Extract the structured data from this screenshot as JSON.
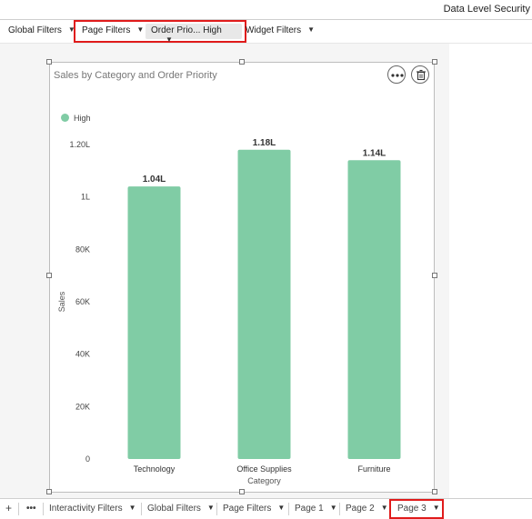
{
  "header": {
    "title": "Data Level Security"
  },
  "filters": {
    "global_label": "Global Filters",
    "page_label": "Page Filters",
    "order_chip": "Order Prio... High",
    "widget_label": "Widget Filters"
  },
  "widget": {
    "title": "Sales by Category and Order Priority",
    "more_icon": "more-dots-icon",
    "delete_icon": "trash-icon"
  },
  "chart_data": {
    "type": "bar",
    "title": "Sales by Category and Order Priority",
    "categories": [
      "Technology",
      "Office Supplies",
      "Furniture"
    ],
    "series": [
      {
        "name": "High",
        "values": [
          104000,
          118000,
          114000
        ],
        "labels": [
          "1.04L",
          "1.18L",
          "1.14L"
        ],
        "color": "#80cca5"
      }
    ],
    "xlabel": "Category",
    "ylabel": "Sales",
    "ylim": [
      0,
      120000
    ],
    "yticks": [
      0,
      20000,
      40000,
      60000,
      80000,
      100000,
      120000
    ],
    "ytick_labels": [
      "0",
      "20K",
      "40K",
      "60K",
      "80K",
      "1L",
      "1.20L"
    ],
    "legend": "top-left",
    "grid": false
  },
  "bottom": {
    "add_label": "+",
    "more_label": "•••",
    "tabs": [
      "Interactivity Filters",
      "Global Filters",
      "Page Filters",
      "Page 1",
      "Page 2",
      "Page 3"
    ]
  }
}
